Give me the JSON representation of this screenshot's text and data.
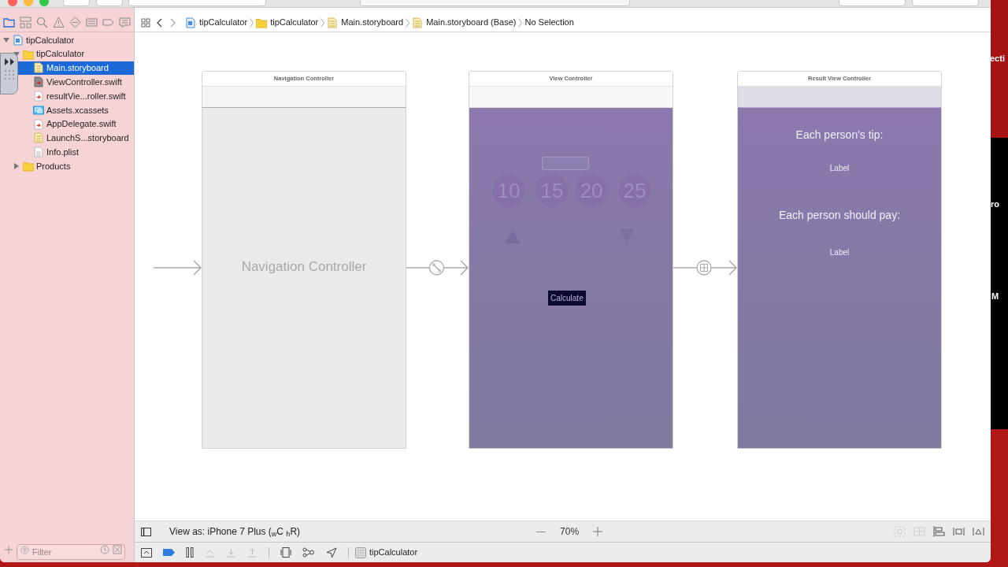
{
  "navigator": {
    "tabs": [
      {
        "kind": "folder",
        "selected": true
      },
      {
        "kind": "hierarchy",
        "selected": false
      },
      {
        "kind": "search",
        "selected": false
      },
      {
        "kind": "warning",
        "selected": false
      },
      {
        "kind": "test",
        "selected": false
      },
      {
        "kind": "debug",
        "selected": false
      },
      {
        "kind": "breakpoint",
        "selected": false
      },
      {
        "kind": "report",
        "selected": false
      }
    ],
    "tree": [
      {
        "name": "tipCalculator",
        "kind": "project",
        "expanded": true,
        "selected": false,
        "children": [
          {
            "name": "tipCalculator",
            "kind": "folder",
            "expanded": true,
            "selected": false,
            "children": [
              {
                "name": "Main.storyboard",
                "kind": "storyboard",
                "selected": true
              },
              {
                "name": "ViewController.swift",
                "kind": "swift-dark",
                "selected": false
              },
              {
                "name": "resultVie...roller.swift",
                "kind": "swift",
                "selected": false
              },
              {
                "name": "Assets.xcassets",
                "kind": "assets",
                "selected": false
              },
              {
                "name": "AppDelegate.swift",
                "kind": "swift",
                "selected": false
              },
              {
                "name": "LaunchS...storyboard",
                "kind": "storyboard",
                "selected": false
              },
              {
                "name": "Info.plist",
                "kind": "plist",
                "selected": false
              }
            ]
          },
          {
            "name": "Products",
            "kind": "folder",
            "expanded": false,
            "selected": false
          }
        ]
      }
    ],
    "filter": {
      "placeholder": "Filter"
    }
  },
  "jump_bar": {
    "path": [
      {
        "label": "tipCalculator",
        "kind": "project"
      },
      {
        "label": "tipCalculator",
        "kind": "folder"
      },
      {
        "label": "Main.storyboard",
        "kind": "storyboard"
      },
      {
        "label": "Main.storyboard (Base)",
        "kind": "storyboard"
      },
      {
        "label": "No Selection",
        "kind": "none"
      }
    ]
  },
  "scenes": [
    {
      "title": "Navigation Controller",
      "kind": "navigation",
      "placeholder": "Navigation Controller"
    },
    {
      "title": "View Controller",
      "kind": "tip",
      "tip_buttons": [
        "10",
        "15",
        "20",
        "25"
      ],
      "button": "Calculate"
    },
    {
      "title": "Result View Controller",
      "kind": "result",
      "lines": [
        {
          "text": "Each person's tip:",
          "kind": "heading"
        },
        {
          "text": "Label",
          "kind": "label"
        },
        {
          "text": "Each person should pay:",
          "kind": "heading"
        },
        {
          "text": "Label",
          "kind": "label"
        }
      ]
    }
  ],
  "bottom_bar": {
    "view_as": "View as: iPhone 7 Plus ($_{w}$C $_{h}$R)",
    "zoom": "70%"
  },
  "debug_bar": {
    "target": "tipCalculator"
  },
  "desktop_fragments": [
    "ecti",
    "ro",
    "M"
  ]
}
